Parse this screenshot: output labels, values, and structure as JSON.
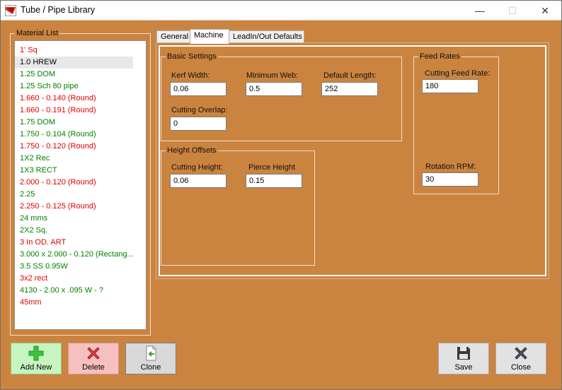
{
  "window": {
    "title": "Tube / Pipe Library",
    "controls": {
      "minimize": "—",
      "maximize": "☐",
      "close": "✕"
    }
  },
  "material_list": {
    "legend": "Material List",
    "selected_index": 1,
    "items": [
      {
        "label": "1' Sq",
        "color": "#e00000"
      },
      {
        "label": "1.0 HREW",
        "color": "#000000"
      },
      {
        "label": "1.25 DOM",
        "color": "#008000"
      },
      {
        "label": "1.25 Sch 80 pipe",
        "color": "#008000"
      },
      {
        "label": "1.660 - 0.140 (Round)",
        "color": "#e00000"
      },
      {
        "label": "1.660 - 0.191 (Round)",
        "color": "#e00000"
      },
      {
        "label": "1.75 DOM",
        "color": "#008000"
      },
      {
        "label": "1.750 - 0.104 (Round)",
        "color": "#008000"
      },
      {
        "label": "1.750 - 0.120 (Round)",
        "color": "#e00000"
      },
      {
        "label": "1X2 Rec",
        "color": "#008000"
      },
      {
        "label": "1X3 RECT",
        "color": "#008000"
      },
      {
        "label": "2.000 - 0.120 (Round)",
        "color": "#e00000"
      },
      {
        "label": "2.25",
        "color": "#008000"
      },
      {
        "label": "2.250 - 0.125 (Round)",
        "color": "#e00000"
      },
      {
        "label": "24 mms",
        "color": "#008000"
      },
      {
        "label": "2X2 Sq.",
        "color": "#008000"
      },
      {
        "label": "3 In OD. ART",
        "color": "#e00000"
      },
      {
        "label": "3.000 x 2.000 - 0.120 (Rectang...",
        "color": "#008000"
      },
      {
        "label": "3.5 SS 0.95W",
        "color": "#008000"
      },
      {
        "label": "3x2 rect",
        "color": "#e00000"
      },
      {
        "label": "4130 - 2.00 x .095  W - ?",
        "color": "#008000"
      },
      {
        "label": "45mm",
        "color": "#e00000"
      }
    ]
  },
  "tabs": [
    {
      "label": "General",
      "active": false
    },
    {
      "label": "Machine",
      "active": true
    },
    {
      "label": "LeadIn/Out Defaults",
      "active": false
    }
  ],
  "basic_settings": {
    "legend": "Basic Settings",
    "kerf_width": {
      "label": "Kerf Width:",
      "value": "0.06"
    },
    "minimum_web": {
      "label": "Minimum Web:",
      "value": "0.5"
    },
    "default_length": {
      "label": "Default Length:",
      "value": "252"
    },
    "cutting_overlap": {
      "label": "Cutting Overlap:",
      "value": "0"
    }
  },
  "height_offsets": {
    "legend": "Height Offsets",
    "cutting_height": {
      "label": "Cutting Height:",
      "value": "0.06"
    },
    "pierce_height": {
      "label": "Pierce Height",
      "value": "0.15"
    }
  },
  "feed_rates": {
    "legend": "Feed Rates",
    "cutting_feed_rate": {
      "label": "Cutting Feed Rate:",
      "value": "180"
    },
    "rotation_rpm": {
      "label": "Rotation RPM:",
      "value": "30"
    }
  },
  "buttons": {
    "add_new": "Add New",
    "delete": "Delete",
    "clone": "Clone",
    "save": "Save",
    "close": "Close"
  },
  "colors": {
    "form_background": "#cb843f",
    "active_item_red": "#e00000",
    "item_green": "#008000"
  }
}
